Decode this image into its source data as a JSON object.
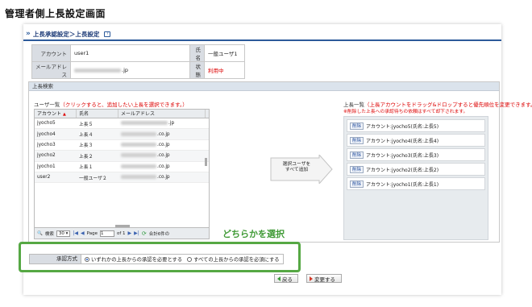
{
  "page_heading": "管理者側上長設定画面",
  "breadcrumb": {
    "arrows": "»",
    "text": "上長承認設定＞上長設定",
    "help": "?"
  },
  "info": {
    "account_label": "アカウント",
    "account_value": "user1",
    "name_label": "氏名",
    "name_value": "一般ユーザ1",
    "email_label": "メールアドレス",
    "email_suffix": ".jp",
    "status_label": "状態",
    "status_value": "利用中",
    "status_color": "#dd0000"
  },
  "search": {
    "header": "上長検索",
    "user_list_title": "ユーザ一覧",
    "user_list_hint": "（クリックすると、追加したい上長を選択できます。）",
    "columns": {
      "account": "アカウント",
      "name": "氏名",
      "email": "メールアドレス"
    },
    "rows": [
      {
        "account": "jyocho5",
        "name": "上長５",
        "email_suffix": ".jp"
      },
      {
        "account": "jyocho4",
        "name": "上長４",
        "email_suffix": ".co.jp"
      },
      {
        "account": "jyocho3",
        "name": "上長３",
        "email_suffix": ".co.jp"
      },
      {
        "account": "jyocho2",
        "name": "上長２",
        "email_suffix": ".co.jp"
      },
      {
        "account": "jyocho1",
        "name": "上長１",
        "email_suffix": ".co.jp"
      },
      {
        "account": "user2",
        "name": "一般ユーザ２",
        "email_suffix": ".co.jp"
      }
    ],
    "pager": {
      "search_label": "検索",
      "per_page": "30",
      "page_label": "Page",
      "page_value": "1",
      "of_label": "of 1",
      "total_label": "合計6件の"
    },
    "add_all_label_1": "選択ユーザを",
    "add_all_label_2": "すべて追加",
    "boss_list_title": "上長一覧",
    "boss_list_hint": "（上長アカウントをドラッグ&ドロップすると優先順位を変更できます。）",
    "boss_note": "※削除した上長への承認待ちの依頼はすべて却下されます。",
    "delete_label": "削除",
    "boss_items": [
      "アカウント:jyocho5(氏名:上長5)",
      "アカウント:jyocho4(氏名:上長4)",
      "アカウント:jyocho3(氏名:上長3)",
      "アカウント:jyocho2(氏名:上長2)",
      "アカウント:jyocho1(氏名:上長1)"
    ]
  },
  "choose_note": "どちらかを選択",
  "approval": {
    "label": "承認方式",
    "option_any": "いずれかの上長からの承認を必要とする",
    "option_all": "すべての上長からの承認を必須にする",
    "selected": "any"
  },
  "buttons": {
    "back": "戻る",
    "change": "変更する"
  },
  "colors": {
    "accent_blue": "#2c5a9a",
    "highlight_green": "#56a844",
    "warning_red": "#dd0000"
  }
}
